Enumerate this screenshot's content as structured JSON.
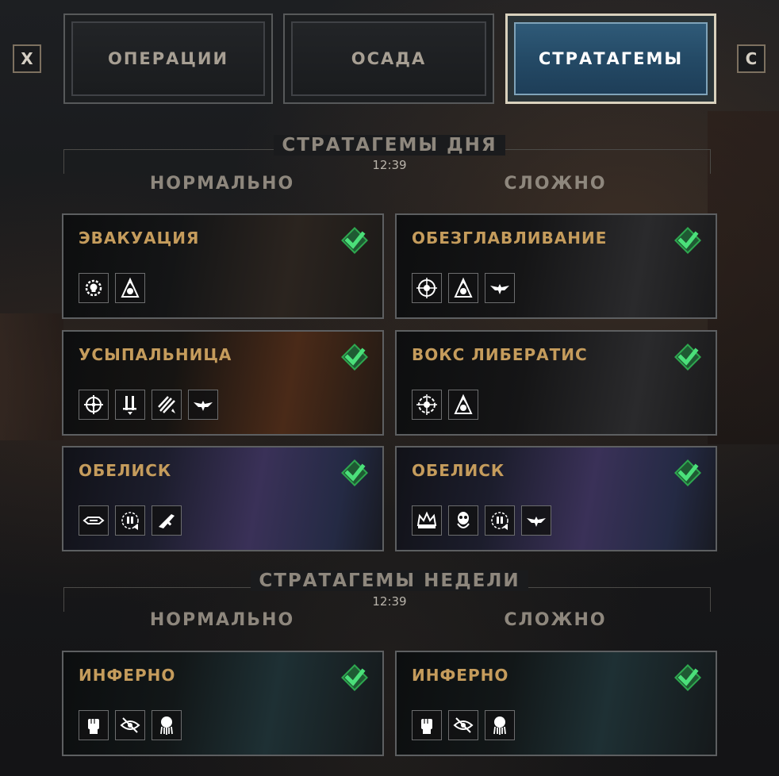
{
  "keys": {
    "prev": "X",
    "next": "C"
  },
  "tabs": [
    {
      "label": "ОПЕРАЦИИ",
      "active": false
    },
    {
      "label": "ОСАДА",
      "active": false
    },
    {
      "label": "СТРАТАГЕМЫ",
      "active": true
    }
  ],
  "daily": {
    "title": "СТРАТАГЕМЫ ДНЯ",
    "timer": "12:39",
    "normal_label": "НОРМАЛЬНО",
    "hard_label": "СЛОЖНО",
    "normal": [
      {
        "title": "ЭВАКУАЦИЯ",
        "completed": true,
        "icons": [
          "gear-skull-icon",
          "hooded-figure-icon"
        ]
      },
      {
        "title": "УСЫПАЛЬНИЦА",
        "completed": true,
        "icons": [
          "crosshair-icon",
          "sword-down-icon",
          "claw-slash-icon",
          "eagle-icon"
        ]
      },
      {
        "title": "ОБЕЛИСК",
        "completed": true,
        "icons": [
          "blade-wide-icon",
          "crosshair-gun-icon",
          "bolter-icon"
        ]
      }
    ],
    "hard": [
      {
        "title": "ОБЕЗГЛАВЛИВАНИЕ",
        "completed": true,
        "icons": [
          "crosshair-skull-icon",
          "hooded-figure-icon",
          "eagle-icon"
        ]
      },
      {
        "title": "ВОКС ЛИБЕРАТИС",
        "completed": true,
        "icons": [
          "crosshair-gear-icon",
          "hooded-figure-icon"
        ]
      },
      {
        "title": "ОБЕЛИСК",
        "completed": true,
        "icons": [
          "crown-icon",
          "skull-robed-icon",
          "crosshair-gun-icon",
          "eagle-icon"
        ]
      }
    ]
  },
  "weekly": {
    "title": "СТРАТАГЕМЫ НЕДЕЛИ",
    "timer": "12:39",
    "normal_label": "НОРМАЛЬНО",
    "hard_label": "СЛОЖНО",
    "normal": [
      {
        "title": "ИНФЕРНО",
        "completed": true,
        "icons": [
          "fist-icon",
          "eye-slash-icon",
          "tentacle-skull-icon"
        ]
      }
    ],
    "hard": [
      {
        "title": "ИНФЕРНО",
        "completed": true,
        "icons": [
          "fist-icon",
          "eye-slash-icon",
          "tentacle-skull-icon"
        ]
      }
    ]
  },
  "colors": {
    "accent": "#c59c5c",
    "check_green": "#3fd46a",
    "active_tab": "#2f5a78"
  }
}
